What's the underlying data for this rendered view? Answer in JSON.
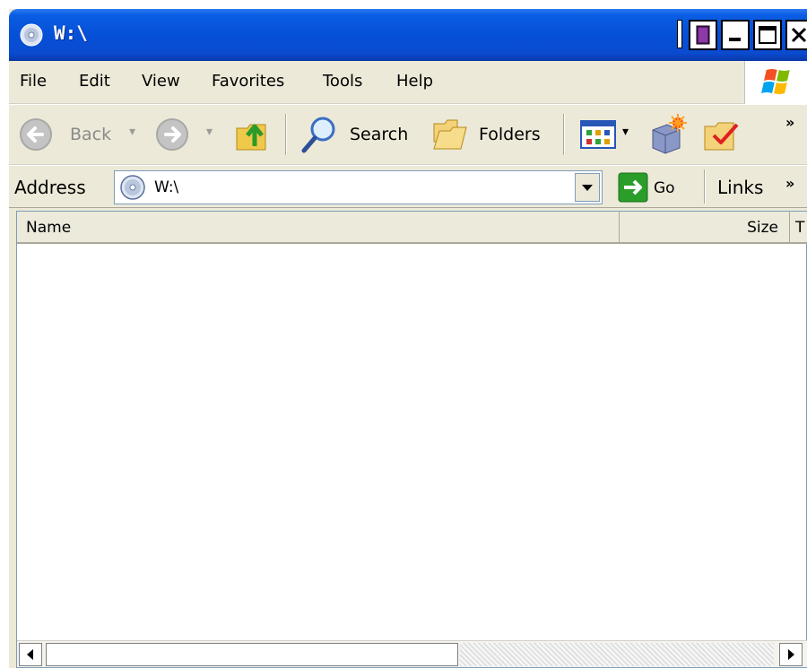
{
  "window": {
    "title": "W:\\",
    "accent_color": "#0a5de3"
  },
  "menu": {
    "items": [
      "File",
      "Edit",
      "View",
      "Favorites",
      "Tools",
      "Help"
    ]
  },
  "toolbar": {
    "back_label": "Back",
    "search_label": "Search",
    "folders_label": "Folders",
    "overflow": "»"
  },
  "address": {
    "label": "Address",
    "value": "W:\\",
    "go_label": "Go",
    "links_label": "Links",
    "links_overflow": "»"
  },
  "list": {
    "columns": [
      "Name",
      "Size",
      "T"
    ],
    "rows": []
  },
  "icons": {
    "title": "cd-drive-icon",
    "windows": "windows-logo-icon",
    "back": "back-arrow-icon",
    "forward": "forward-arrow-icon",
    "up": "folder-up-icon",
    "search": "magnifier-icon",
    "folders": "folders-icon",
    "views": "views-icon",
    "go": "go-arrow-icon"
  }
}
